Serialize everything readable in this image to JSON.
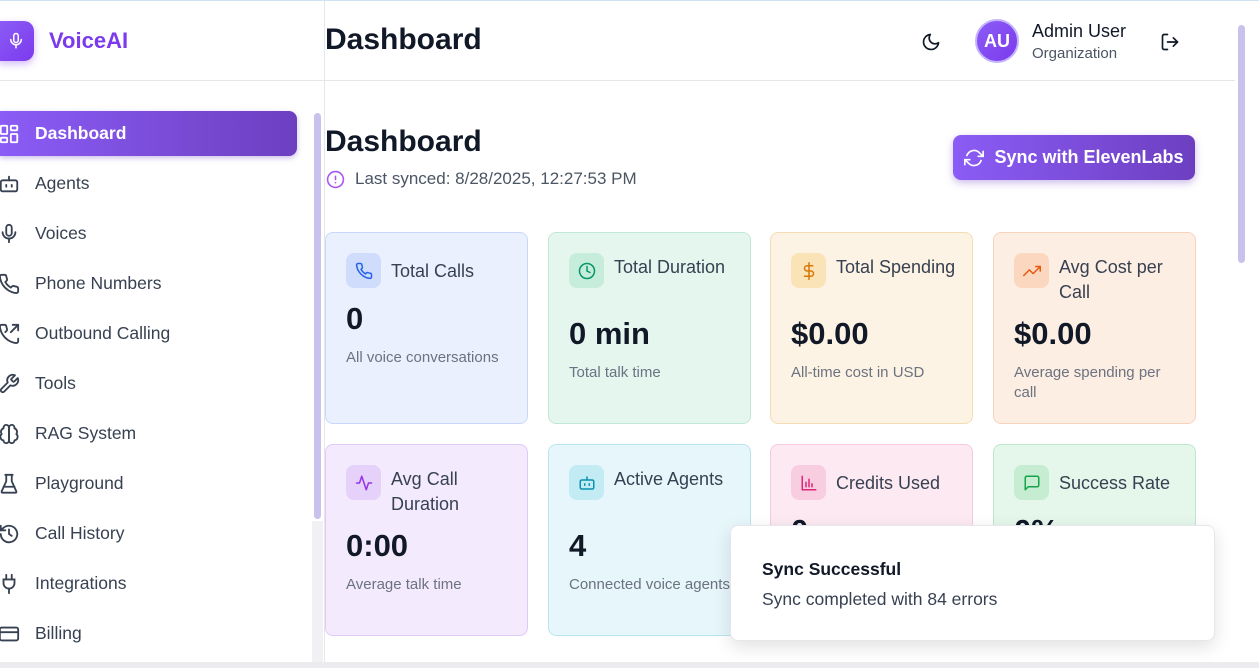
{
  "brand": {
    "name": "VoiceAI",
    "icon": "microphone-icon",
    "color": "#7c3aed"
  },
  "sidebar": {
    "items": [
      {
        "label": "Dashboard",
        "icon": "dashboard-icon",
        "active": true
      },
      {
        "label": "Agents",
        "icon": "bot-icon"
      },
      {
        "label": "Voices",
        "icon": "microphone-icon"
      },
      {
        "label": "Phone Numbers",
        "icon": "phone-icon"
      },
      {
        "label": "Outbound Calling",
        "icon": "phone-outgoing-icon"
      },
      {
        "label": "Tools",
        "icon": "wrench-icon"
      },
      {
        "label": "RAG System",
        "icon": "brain-icon"
      },
      {
        "label": "Playground",
        "icon": "flask-icon"
      },
      {
        "label": "Call History",
        "icon": "history-icon"
      },
      {
        "label": "Integrations",
        "icon": "plug-icon"
      },
      {
        "label": "Billing",
        "icon": "credit-card-icon"
      }
    ]
  },
  "header": {
    "title": "Dashboard",
    "user": {
      "initials": "AU",
      "name": "Admin User",
      "org": "Organization"
    }
  },
  "main": {
    "title": "Dashboard",
    "last_synced": "Last synced: 8/28/2025, 12:27:53 PM",
    "sync_button": "Sync with ElevenLabs",
    "cards": [
      {
        "title": "Total Calls",
        "value": "0",
        "desc": "All voice conversations",
        "icon": "phone-icon",
        "accent": "#2563eb"
      },
      {
        "title": "Total Duration",
        "value": "0 min",
        "desc": "Total talk time",
        "icon": "clock-icon",
        "accent": "#059669"
      },
      {
        "title": "Total Spending",
        "value": "$0.00",
        "desc": "All-time cost in USD",
        "icon": "dollar-icon",
        "accent": "#d97706"
      },
      {
        "title": "Avg Cost per Call",
        "value": "$0.00",
        "desc": "Average spending per call",
        "icon": "trending-up-icon",
        "accent": "#ea580c"
      },
      {
        "title": "Avg Call Duration",
        "value": "0:00",
        "desc": "Average talk time",
        "icon": "activity-icon",
        "accent": "#9333ea"
      },
      {
        "title": "Active Agents",
        "value": "4",
        "desc": "Connected voice agents",
        "icon": "bot-icon",
        "accent": "#0891b2"
      },
      {
        "title": "Credits Used",
        "value": "0",
        "desc": "",
        "icon": "bar-chart-icon",
        "accent": "#db2777"
      },
      {
        "title": "Success Rate",
        "value": "0%",
        "desc": "",
        "icon": "message-square-icon",
        "accent": "#16a34a"
      }
    ]
  },
  "toast": {
    "title": "Sync Successful",
    "message": "Sync completed with 84 errors"
  }
}
